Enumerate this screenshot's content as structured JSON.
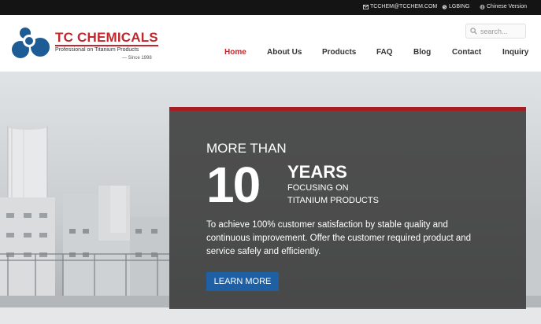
{
  "topbar": {
    "email": "TCCHEM@TCCHEM.COM",
    "skype": "LGBING",
    "language": "Chinese Version"
  },
  "brand": {
    "name": "TC CHEMICALS",
    "tagline": "Professional on Titanium Products",
    "since": "— Since 1998",
    "color": "#c1272d",
    "logo_color": "#1e5c95"
  },
  "search": {
    "placeholder": "search..."
  },
  "nav": {
    "items": [
      {
        "label": "Home",
        "active": true
      },
      {
        "label": "About Us"
      },
      {
        "label": "Products"
      },
      {
        "label": "FAQ"
      },
      {
        "label": "Blog"
      },
      {
        "label": "Contact"
      },
      {
        "label": "Inquiry"
      }
    ]
  },
  "hero": {
    "more_than": "MORE THAN",
    "number": "10",
    "years": "YEARS",
    "focus_line1": "FOCUSING ON",
    "focus_line2": "TITANIUM PRODUCTS",
    "description": "To achieve 100% customer satisfaction by stable quality and continuous improvement. Offer the customer required product and service safely and efficiently.",
    "button": "LEARN MORE",
    "accent": "#a31d22",
    "button_color": "#1f5fa3"
  }
}
